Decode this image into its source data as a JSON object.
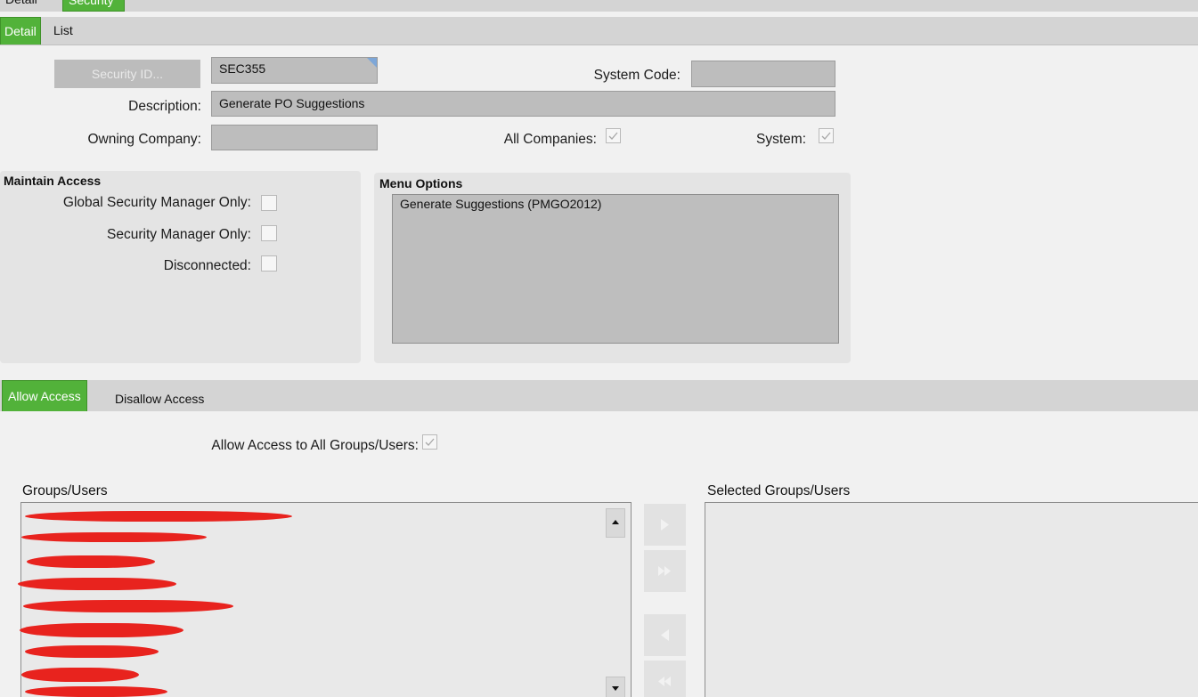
{
  "top_tabs": [
    "Detail",
    "Security"
  ],
  "sub_tabs": [
    "Detail",
    "List"
  ],
  "form": {
    "security_id_button": "Security ID...",
    "security_id_value": "SEC355",
    "system_code_label": "System Code:",
    "system_code_value": "",
    "description_label": "Description:",
    "description_value": "Generate PO Suggestions",
    "owning_company_label": "Owning Company:",
    "owning_company_value": "",
    "all_companies_label": "All Companies:",
    "all_companies_checked": true,
    "system_label": "System:",
    "system_checked": true
  },
  "maintain_access": {
    "title": "Maintain Access",
    "global_security_manager_label": "Global Security Manager Only:",
    "security_manager_label": "Security Manager Only:",
    "disconnected_label": "Disconnected:"
  },
  "menu_options": {
    "title": "Menu Options",
    "items": [
      "Generate Suggestions (PMGO2012)"
    ]
  },
  "access_tabs": [
    "Allow Access",
    "Disallow Access"
  ],
  "allow_all": {
    "label": "Allow Access to All Groups/Users:",
    "checked": true
  },
  "groups_users_label": "Groups/Users",
  "selected_groups_users_label": "Selected Groups/Users",
  "colors": {
    "active_tab": "#52b23a",
    "redaction": "#e8231e"
  }
}
